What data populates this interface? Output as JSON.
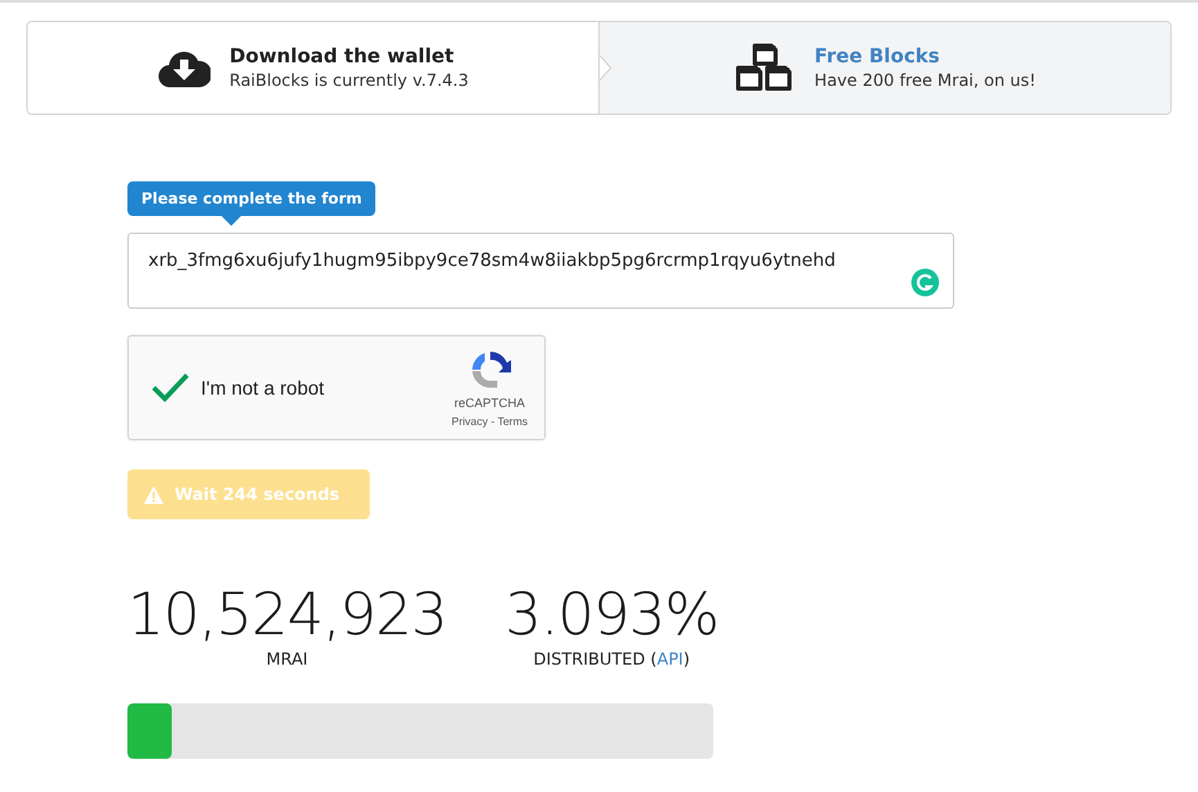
{
  "steps": [
    {
      "title": "Download the wallet",
      "subtitle": "RaiBlocks is currently v.7.4.3",
      "selected": false,
      "kind": "download"
    },
    {
      "title": "Free Blocks",
      "subtitle": "Have 200 free Mrai, on us!",
      "selected": true,
      "kind": "blocks"
    }
  ],
  "form": {
    "tooltip": "Please complete the form",
    "address": "xrb_3fmg6xu6jufy1hugm95ibpy9ce78sm4w8iiakbp5pg6rcrmp1rqyu6ytnehd",
    "captcha": {
      "label": "I'm not a robot",
      "checked": true,
      "brand": "reCAPTCHA",
      "links": "Privacy - Terms"
    },
    "button": {
      "label": "Wait 244 seconds",
      "disabled": true
    }
  },
  "stats": {
    "amount": "10,524,923",
    "amount_label": "MRAI",
    "percent": "3.093%",
    "percent_label_before": "DISTRIBUTED (",
    "api_link": "API",
    "percent_label_after": ")"
  },
  "progress": {
    "level": 0.076
  }
}
